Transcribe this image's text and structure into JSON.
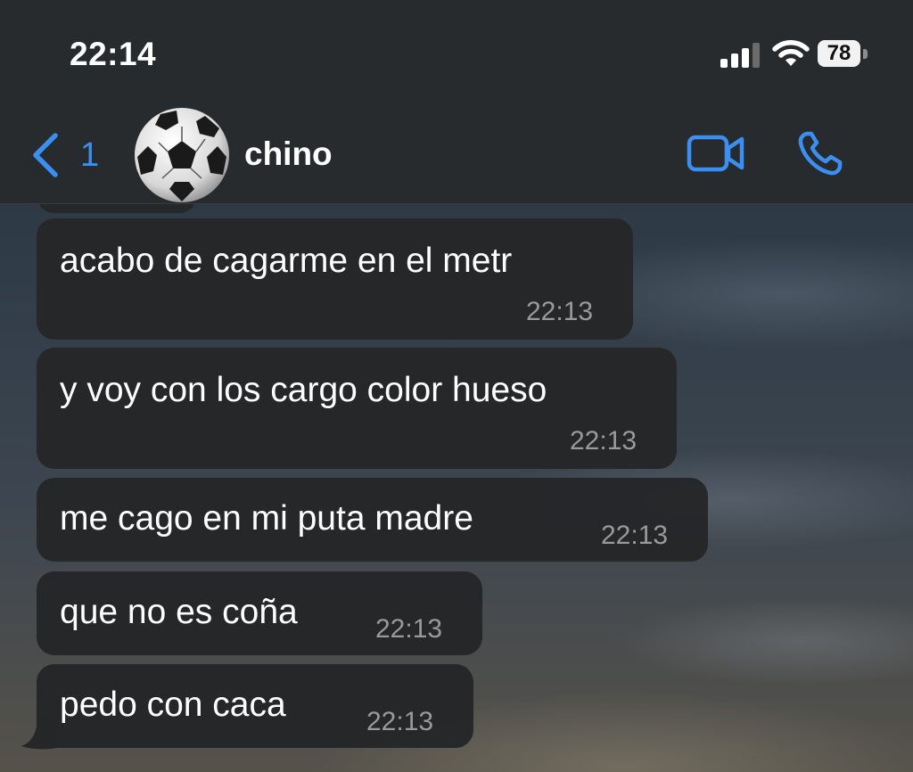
{
  "status_bar": {
    "time": "22:14",
    "battery_level": "78",
    "signal_icon": "cellular-signal-icon",
    "wifi_icon": "wifi-icon"
  },
  "header": {
    "back_count": "1",
    "contact_name": "chino",
    "avatar": "soccer-ball-emoji",
    "accent_color": "#3b8ff0"
  },
  "messages": [
    {
      "text": "acabo de cagarme en el metr",
      "time": "22:13"
    },
    {
      "text": "y voy con los cargo color hueso",
      "time": "22:13"
    },
    {
      "text": "me cago en mi puta madre",
      "time": "22:13"
    },
    {
      "text": "que no es coña",
      "time": "22:13"
    },
    {
      "text": "pedo con caca",
      "time": "22:13"
    }
  ]
}
